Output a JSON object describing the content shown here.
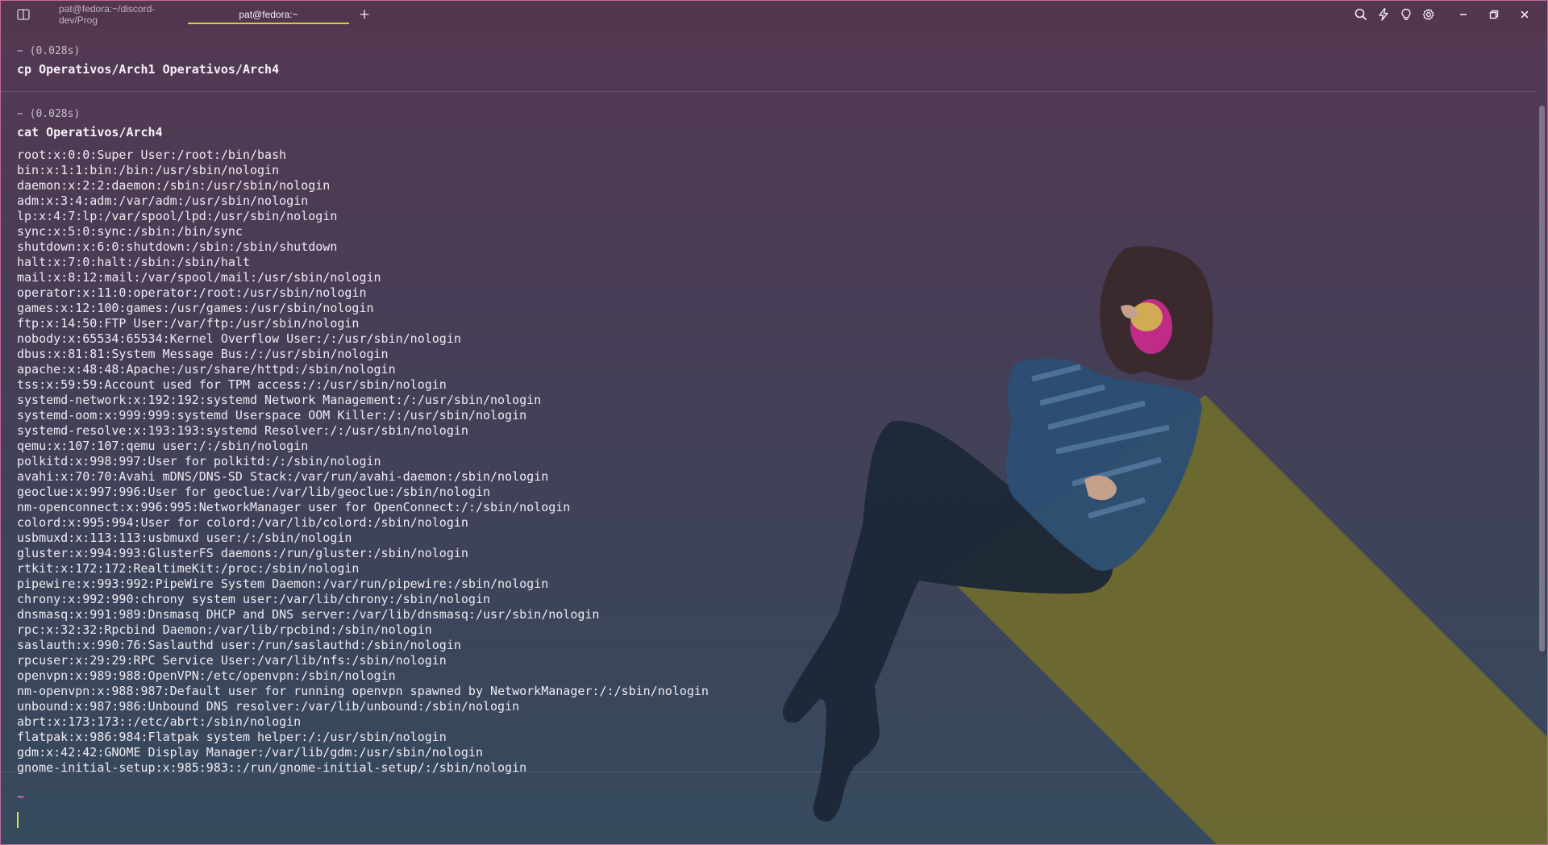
{
  "tabs": [
    {
      "label": "pat@fedora:~/discord-dev/Prog",
      "active": false
    },
    {
      "label": "pat@fedora:~",
      "active": true
    }
  ],
  "toolbar_icons": [
    "search-icon",
    "lightning-icon",
    "lightbulb-icon",
    "settings-icon"
  ],
  "window_controls": [
    "minimize-icon",
    "restore-icon",
    "close-icon"
  ],
  "colors": {
    "accent": "#d7cc3c",
    "prompt": "#e675c5",
    "cursor": "#e6da3a"
  },
  "blocks": [
    {
      "meta": "~ (0.028s)",
      "command": "cp Operativos/Arch1 Operativos/Arch4"
    },
    {
      "meta": "~ (0.028s)",
      "command": "cat Operativos/Arch4"
    }
  ],
  "output_lines": [
    "root:x:0:0:Super User:/root:/bin/bash",
    "bin:x:1:1:bin:/bin:/usr/sbin/nologin",
    "daemon:x:2:2:daemon:/sbin:/usr/sbin/nologin",
    "adm:x:3:4:adm:/var/adm:/usr/sbin/nologin",
    "lp:x:4:7:lp:/var/spool/lpd:/usr/sbin/nologin",
    "sync:x:5:0:sync:/sbin:/bin/sync",
    "shutdown:x:6:0:shutdown:/sbin:/sbin/shutdown",
    "halt:x:7:0:halt:/sbin:/sbin/halt",
    "mail:x:8:12:mail:/var/spool/mail:/usr/sbin/nologin",
    "operator:x:11:0:operator:/root:/usr/sbin/nologin",
    "games:x:12:100:games:/usr/games:/usr/sbin/nologin",
    "ftp:x:14:50:FTP User:/var/ftp:/usr/sbin/nologin",
    "nobody:x:65534:65534:Kernel Overflow User:/:/usr/sbin/nologin",
    "dbus:x:81:81:System Message Bus:/:/usr/sbin/nologin",
    "apache:x:48:48:Apache:/usr/share/httpd:/sbin/nologin",
    "tss:x:59:59:Account used for TPM access:/:/usr/sbin/nologin",
    "systemd-network:x:192:192:systemd Network Management:/:/usr/sbin/nologin",
    "systemd-oom:x:999:999:systemd Userspace OOM Killer:/:/usr/sbin/nologin",
    "systemd-resolve:x:193:193:systemd Resolver:/:/usr/sbin/nologin",
    "qemu:x:107:107:qemu user:/:/sbin/nologin",
    "polkitd:x:998:997:User for polkitd:/:/sbin/nologin",
    "avahi:x:70:70:Avahi mDNS/DNS-SD Stack:/var/run/avahi-daemon:/sbin/nologin",
    "geoclue:x:997:996:User for geoclue:/var/lib/geoclue:/sbin/nologin",
    "nm-openconnect:x:996:995:NetworkManager user for OpenConnect:/:/sbin/nologin",
    "colord:x:995:994:User for colord:/var/lib/colord:/sbin/nologin",
    "usbmuxd:x:113:113:usbmuxd user:/:/sbin/nologin",
    "gluster:x:994:993:GlusterFS daemons:/run/gluster:/sbin/nologin",
    "rtkit:x:172:172:RealtimeKit:/proc:/sbin/nologin",
    "pipewire:x:993:992:PipeWire System Daemon:/var/run/pipewire:/sbin/nologin",
    "chrony:x:992:990:chrony system user:/var/lib/chrony:/sbin/nologin",
    "dnsmasq:x:991:989:Dnsmasq DHCP and DNS server:/var/lib/dnsmasq:/usr/sbin/nologin",
    "rpc:x:32:32:Rpcbind Daemon:/var/lib/rpcbind:/sbin/nologin",
    "saslauth:x:990:76:Saslauthd user:/run/saslauthd:/sbin/nologin",
    "rpcuser:x:29:29:RPC Service User:/var/lib/nfs:/sbin/nologin",
    "openvpn:x:989:988:OpenVPN:/etc/openvpn:/sbin/nologin",
    "nm-openvpn:x:988:987:Default user for running openvpn spawned by NetworkManager:/:/sbin/nologin",
    "unbound:x:987:986:Unbound DNS resolver:/var/lib/unbound:/sbin/nologin",
    "abrt:x:173:173::/etc/abrt:/sbin/nologin",
    "flatpak:x:986:984:Flatpak system helper:/:/usr/sbin/nologin",
    "gdm:x:42:42:GNOME Display Manager:/var/lib/gdm:/usr/sbin/nologin",
    "gnome-initial-setup:x:985:983::/run/gnome-initial-setup/:/sbin/nologin"
  ],
  "prompt": {
    "text": "~"
  }
}
